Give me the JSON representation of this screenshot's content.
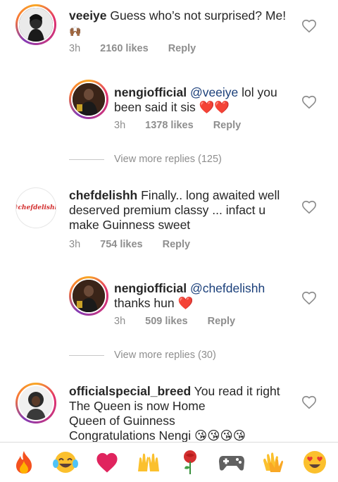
{
  "comments": [
    {
      "username": "veeiye",
      "text": " Guess who’s not surprised? Me!",
      "text2": "🙌🏾",
      "time": "3h",
      "likes": "2160 likes",
      "reply": "Reply"
    },
    {
      "username": "nengiofficial",
      "mention": "@veeiye",
      "text": " lol you",
      "text2": "been said it sis ❤️❤️",
      "time": "3h",
      "likes": "1378 likes",
      "reply": "Reply"
    },
    {
      "view_more": "View more replies (125)"
    },
    {
      "username": "chefdelishh",
      "avatar_text": "#chefdelishh",
      "text": " Finally.. long awaited well",
      "text2": "deserved premium classy ... infact u",
      "text3": "make Guinness sweet",
      "time": "3h",
      "likes": "754 likes",
      "reply": "Reply"
    },
    {
      "username": "nengiofficial",
      "mention": "@chefdelishh",
      "text2": "thanks hun ❤️",
      "time": "3h",
      "likes": "509 likes",
      "reply": "Reply"
    },
    {
      "view_more": "View more replies (30)"
    },
    {
      "username": "officialspecial_breed",
      "text": " You read it right",
      "text2": "The Queen is now Home",
      "text3": "Queen of Guinness",
      "text4": "Congratulations Nengi 😘😘😘😘"
    }
  ],
  "emoji_bar": [
    "🔥",
    "😂",
    "❤️",
    "🙌",
    "🌹",
    "🎮",
    "👏",
    "😍"
  ],
  "colors": {
    "mention": "#1a3f7a",
    "meta": "#8e8e8e",
    "heart_outline": "#8e8e8e",
    "red_heart": "#e0245e"
  }
}
